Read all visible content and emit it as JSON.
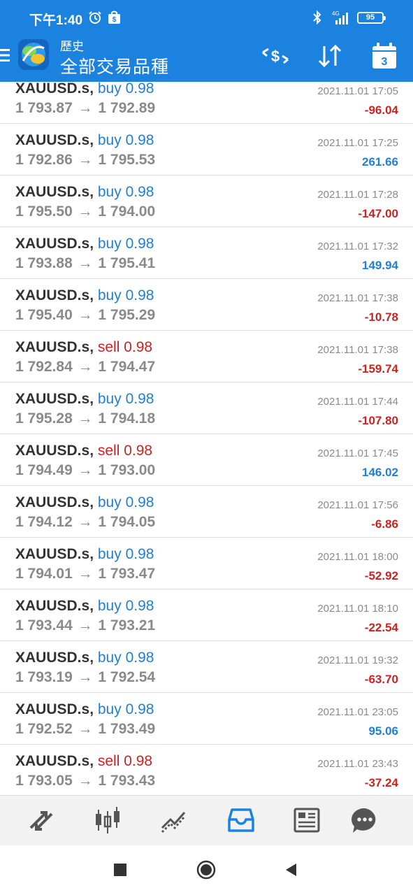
{
  "status_bar": {
    "time": "下午1:40",
    "battery": "95",
    "network": "4G",
    "icons": [
      "alarm-icon",
      "shopping-bag-icon",
      "bluetooth-icon",
      "signal-icon",
      "battery-icon"
    ]
  },
  "header": {
    "subtitle": "歷史",
    "title": "全部交易品種",
    "calendar_day": "3",
    "accent_color": "#1b82e0"
  },
  "trades": [
    {
      "symbol": "XAUUSD.s",
      "type": "buy",
      "volume": "0.98",
      "open_price": "1 793.87",
      "close_price": "1 792.89",
      "time": "2021.11.01 17:05",
      "profit": "-96.04"
    },
    {
      "symbol": "XAUUSD.s",
      "type": "buy",
      "volume": "0.98",
      "open_price": "1 792.86",
      "close_price": "1 795.53",
      "time": "2021.11.01 17:25",
      "profit": "261.66"
    },
    {
      "symbol": "XAUUSD.s",
      "type": "buy",
      "volume": "0.98",
      "open_price": "1 795.50",
      "close_price": "1 794.00",
      "time": "2021.11.01 17:28",
      "profit": "-147.00"
    },
    {
      "symbol": "XAUUSD.s",
      "type": "buy",
      "volume": "0.98",
      "open_price": "1 793.88",
      "close_price": "1 795.41",
      "time": "2021.11.01 17:32",
      "profit": "149.94"
    },
    {
      "symbol": "XAUUSD.s",
      "type": "buy",
      "volume": "0.98",
      "open_price": "1 795.40",
      "close_price": "1 795.29",
      "time": "2021.11.01 17:38",
      "profit": "-10.78"
    },
    {
      "symbol": "XAUUSD.s",
      "type": "sell",
      "volume": "0.98",
      "open_price": "1 792.84",
      "close_price": "1 794.47",
      "time": "2021.11.01 17:38",
      "profit": "-159.74"
    },
    {
      "symbol": "XAUUSD.s",
      "type": "buy",
      "volume": "0.98",
      "open_price": "1 795.28",
      "close_price": "1 794.18",
      "time": "2021.11.01 17:44",
      "profit": "-107.80"
    },
    {
      "symbol": "XAUUSD.s",
      "type": "sell",
      "volume": "0.98",
      "open_price": "1 794.49",
      "close_price": "1 793.00",
      "time": "2021.11.01 17:45",
      "profit": "146.02"
    },
    {
      "symbol": "XAUUSD.s",
      "type": "buy",
      "volume": "0.98",
      "open_price": "1 794.12",
      "close_price": "1 794.05",
      "time": "2021.11.01 17:56",
      "profit": "-6.86"
    },
    {
      "symbol": "XAUUSD.s",
      "type": "buy",
      "volume": "0.98",
      "open_price": "1 794.01",
      "close_price": "1 793.47",
      "time": "2021.11.01 18:00",
      "profit": "-52.92"
    },
    {
      "symbol": "XAUUSD.s",
      "type": "buy",
      "volume": "0.98",
      "open_price": "1 793.44",
      "close_price": "1 793.21",
      "time": "2021.11.01 18:10",
      "profit": "-22.54"
    },
    {
      "symbol": "XAUUSD.s",
      "type": "buy",
      "volume": "0.98",
      "open_price": "1 793.19",
      "close_price": "1 792.54",
      "time": "2021.11.01 19:32",
      "profit": "-63.70"
    },
    {
      "symbol": "XAUUSD.s",
      "type": "buy",
      "volume": "0.98",
      "open_price": "1 792.52",
      "close_price": "1 793.49",
      "time": "2021.11.01 23:05",
      "profit": "95.06"
    },
    {
      "symbol": "XAUUSD.s",
      "type": "sell",
      "volume": "0.98",
      "open_price": "1 793.05",
      "close_price": "1 793.43",
      "time": "2021.11.01 23:43",
      "profit": "-37.24"
    }
  ],
  "colors": {
    "buy": "#1f7fd6",
    "sell": "#cc2222",
    "profit_positive": "#1f7fd6",
    "profit_negative": "#cc2222"
  },
  "bottom_tabs": [
    {
      "name": "quotes-tab",
      "icon": "quotes-arrows-icon",
      "active": false
    },
    {
      "name": "chart-tab",
      "icon": "candlestick-icon",
      "active": false
    },
    {
      "name": "trade-tab",
      "icon": "trend-line-icon",
      "active": false
    },
    {
      "name": "history-tab",
      "icon": "inbox-tray-icon",
      "active": true
    },
    {
      "name": "news-tab",
      "icon": "newspaper-icon",
      "active": false
    },
    {
      "name": "messages-tab",
      "icon": "chat-bubble-icon",
      "active": false
    }
  ],
  "system_nav": [
    "recent-apps-icon",
    "home-icon",
    "back-icon"
  ]
}
